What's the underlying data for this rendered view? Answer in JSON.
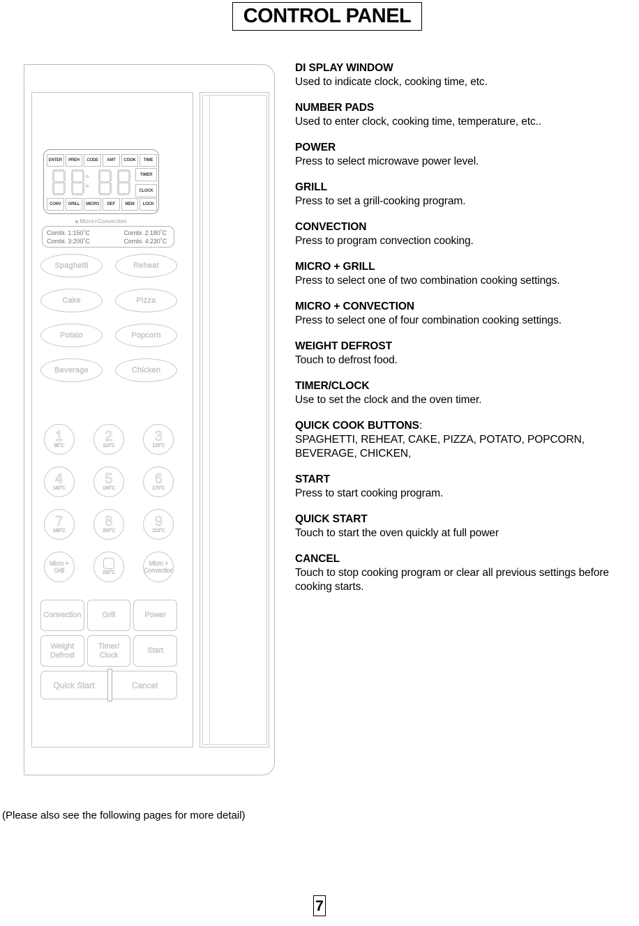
{
  "page": {
    "title": "CONTROL PANEL",
    "footer_note": "(Please also see the following pages for more detail)",
    "page_number": "7"
  },
  "control_panel": {
    "display": {
      "top_indicators": [
        "ENTER",
        "PREH",
        "CODE",
        "AMT",
        "COOK",
        "TIME"
      ],
      "bottom_indicators": [
        "CONV",
        "GRILL",
        "MICRO",
        "DEF",
        "MEM",
        "LOCK"
      ],
      "side_indicators": [
        "TIMER",
        "CLOCK"
      ],
      "digits": "88:88"
    },
    "micro_convection_caption": "Micro+Convection",
    "combi_settings": [
      "Combi. 1:150˚C",
      "Combi. 2:180˚C",
      "Combi. 3:200˚C",
      "Combi. 4:230˚C"
    ],
    "quick_cook_buttons": [
      "Spaghetti",
      "Reheat",
      "Cake",
      "Pizza",
      "Potato",
      "Popcorn",
      "Beverage",
      "Chicken"
    ],
    "number_pads": [
      {
        "digit": "1",
        "temp": "95˚C"
      },
      {
        "digit": "2",
        "temp": "110˚C"
      },
      {
        "digit": "3",
        "temp": "125˚C"
      },
      {
        "digit": "4",
        "temp": "140˚C"
      },
      {
        "digit": "5",
        "temp": "155˚C"
      },
      {
        "digit": "6",
        "temp": "170˚C"
      },
      {
        "digit": "7",
        "temp": "185˚C"
      },
      {
        "digit": "8",
        "temp": "200˚C"
      },
      {
        "digit": "9",
        "temp": "215˚C"
      }
    ],
    "combo_row": {
      "left_label": "Micro +\nGrill",
      "center_temp": "230˚C",
      "right_label": "Micro +\nConvection"
    },
    "function_buttons": [
      "Convection",
      "Grill",
      "Power",
      "Weight\nDefrost",
      "Timer/\nClock",
      "Start"
    ],
    "bottom_bar": {
      "quick_start": "Quick Start",
      "cancel": "Cancel"
    }
  },
  "descriptions": [
    {
      "title": "DI SPLAY WINDOW",
      "body": "Used to indicate clock, cooking time, etc."
    },
    {
      "title": "NUMBER PADS",
      "body": "Used to enter clock, cooking time, temperature, etc.."
    },
    {
      "title": "POWER",
      "body": "Press to select microwave power level."
    },
    {
      "title": "GRILL",
      "body": "Press to set a grill-cooking program."
    },
    {
      "title": "CONVECTION",
      "body": "Press to program convection cooking."
    },
    {
      "title": "MICRO + GRILL",
      "body": "Press to select one of two combination cooking settings."
    },
    {
      "title": "MICRO + CONVECTION",
      "body": "Press to select one of four combination cooking settings."
    },
    {
      "title": "WEIGHT DEFROST",
      "body": "Touch to defrost food."
    },
    {
      "title": "TIMER/CLOCK",
      "body": "Use to set the clock and the oven timer."
    },
    {
      "title": "QUICK COOK BUTTONS",
      "title_suffix": ":",
      "body": "SPAGHETTI, REHEAT, CAKE, PIZZA, POTATO, POPCORN, BEVERAGE, CHICKEN,"
    },
    {
      "title": "START",
      "body": "Press to start cooking program."
    },
    {
      "title": "QUICK START",
      "body": "Touch to start the oven quickly at full power"
    },
    {
      "title": "CANCEL",
      "body": "Touch to stop cooking program or clear all previous settings before cooking starts."
    }
  ]
}
